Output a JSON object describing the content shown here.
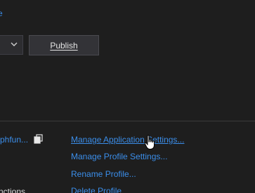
{
  "header": {
    "top_link": "e"
  },
  "toolbar": {
    "publish_label": "Publish"
  },
  "profile": {
    "name_fragment": "phfun...",
    "functions_fragment": "nctions"
  },
  "actions": [
    {
      "label": "Manage Application Settings..."
    },
    {
      "label": "Manage Profile Settings..."
    },
    {
      "label": "Rename Profile..."
    },
    {
      "label": "Delete Profile"
    }
  ],
  "colors": {
    "background": "#1e1e1e",
    "link": "#3b8eea",
    "text": "#d7d7d7",
    "button_bg": "#333337",
    "button_border": "#4a4a4f"
  },
  "icons": {
    "copy": "copy-icon",
    "dropdown": "chevron-down-icon",
    "cursor": "hand-pointer-cursor"
  }
}
